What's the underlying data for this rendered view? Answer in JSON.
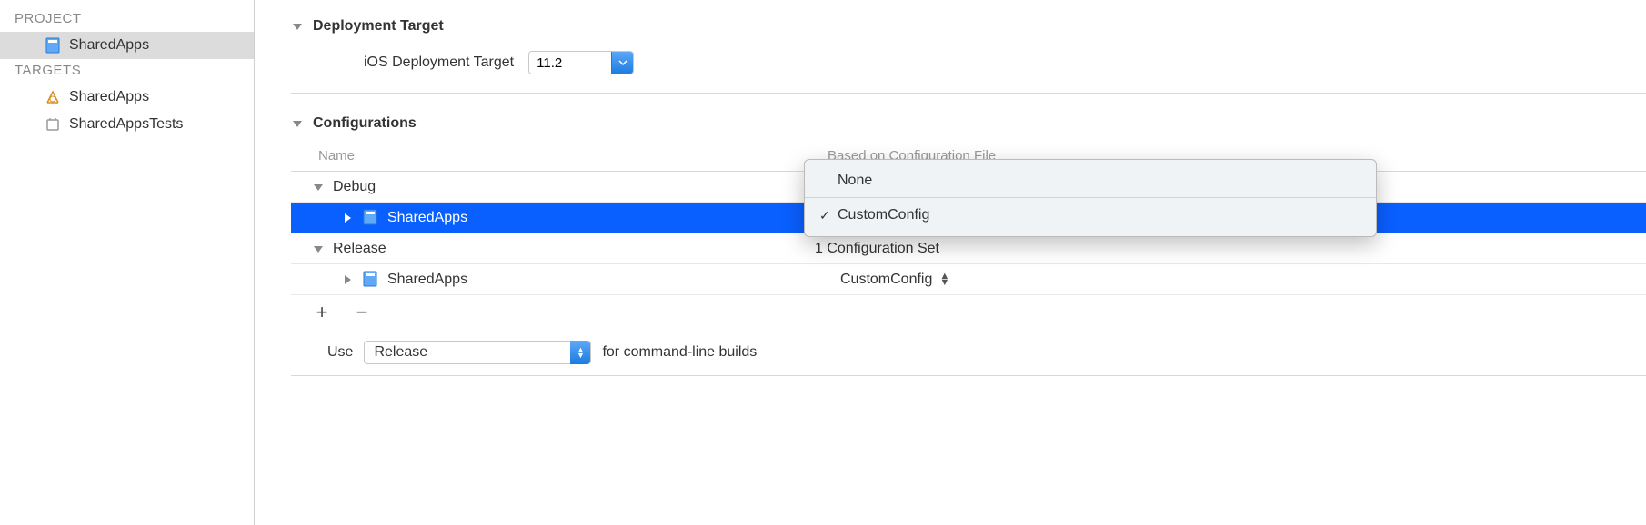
{
  "sidebar": {
    "project_header": "PROJECT",
    "targets_header": "TARGETS",
    "project_item": "SharedApps",
    "targets": [
      "SharedApps",
      "SharedAppsTests"
    ]
  },
  "deployment": {
    "section_title": "Deployment Target",
    "field_label": "iOS Deployment Target",
    "value": "11.2"
  },
  "configurations": {
    "section_title": "Configurations",
    "col_name": "Name",
    "col_config": "Based on Configuration File",
    "rows": {
      "debug": {
        "name": "Debug"
      },
      "debug_child": {
        "name": "SharedApps"
      },
      "release": {
        "name": "Release",
        "config": "1 Configuration Set"
      },
      "release_child": {
        "name": "SharedApps",
        "config": "CustomConfig"
      }
    },
    "use_label": "Use",
    "use_value": "Release",
    "use_suffix": "for command-line builds"
  },
  "dropdown": {
    "items": [
      {
        "label": "None",
        "checked": false
      },
      {
        "label": "CustomConfig",
        "checked": true
      }
    ]
  }
}
